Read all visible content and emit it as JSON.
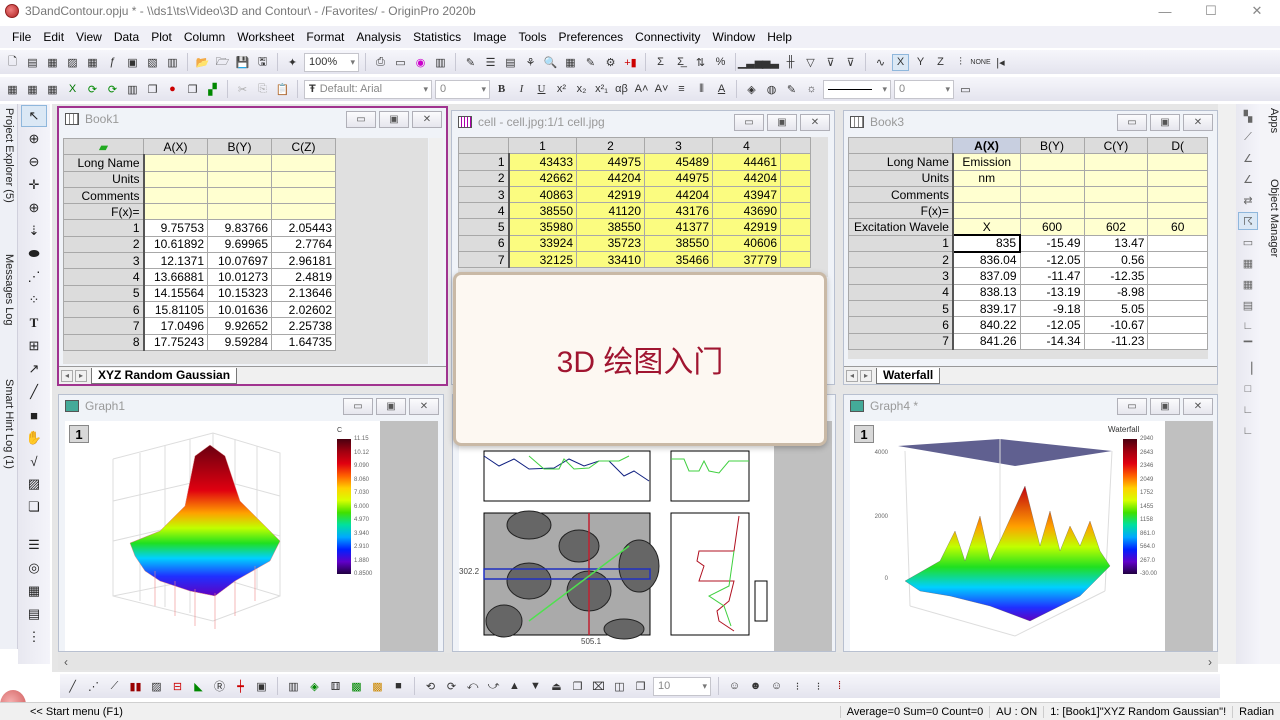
{
  "window": {
    "title": "3DandContour.opju * - \\\\ds1\\ts\\Video\\3D and Contour\\ - /Favorites/ - OriginPro 2020b",
    "controls": [
      "—",
      "☐",
      "✕"
    ]
  },
  "menu": [
    "File",
    "Edit",
    "View",
    "Data",
    "Plot",
    "Column",
    "Worksheet",
    "Format",
    "Analysis",
    "Statistics",
    "Image",
    "Tools",
    "Preferences",
    "Connectivity",
    "Window",
    "Help"
  ],
  "toolbar": {
    "zoom_value": "100%",
    "font_value": "Default: Arial",
    "font_size": "0",
    "line_width": "0",
    "bottom_size": "10"
  },
  "left_tabs": [
    "Project Explorer (5)",
    "Messages Log",
    "Smart Hint Log (1)"
  ],
  "right_tabs": [
    "Apps",
    "Object Manager"
  ],
  "book1": {
    "title": "Book1",
    "columns": [
      "A(X)",
      "B(Y)",
      "C(Z)"
    ],
    "meta_rows": [
      "Long Name",
      "Units",
      "Comments",
      "F(x)="
    ],
    "rows": [
      [
        "1",
        "9.75753",
        "9.83766",
        "2.05443"
      ],
      [
        "2",
        "10.61892",
        "9.69965",
        "2.7764"
      ],
      [
        "3",
        "12.1371",
        "10.07697",
        "2.96181"
      ],
      [
        "4",
        "13.66881",
        "10.01273",
        "2.4819"
      ],
      [
        "5",
        "14.15564",
        "10.15323",
        "2.13646"
      ],
      [
        "6",
        "15.81105",
        "10.01636",
        "2.02602"
      ],
      [
        "7",
        "17.0496",
        "9.92652",
        "2.25738"
      ],
      [
        "8",
        "17.75243",
        "9.59284",
        "1.64735"
      ]
    ],
    "sheet_tab": "XYZ Random Gaussian"
  },
  "cell": {
    "title": "cell - cell.jpg:1/1 cell.jpg",
    "columns": [
      "1",
      "2",
      "3",
      "4"
    ],
    "rows": [
      [
        "1",
        "43433",
        "44975",
        "45489",
        "44461"
      ],
      [
        "2",
        "42662",
        "44204",
        "44975",
        "44204"
      ],
      [
        "3",
        "40863",
        "42919",
        "44204",
        "43947"
      ],
      [
        "4",
        "38550",
        "41120",
        "43176",
        "43690"
      ],
      [
        "5",
        "35980",
        "38550",
        "41377",
        "42919"
      ],
      [
        "6",
        "33924",
        "35723",
        "38550",
        "40606"
      ],
      [
        "7",
        "32125",
        "33410",
        "35466",
        "37779"
      ]
    ]
  },
  "book3": {
    "title": "Book3",
    "columns": [
      "A(X)",
      "B(Y)",
      "C(Y)",
      "D("
    ],
    "meta": [
      [
        "Long Name",
        "Emission",
        "",
        ""
      ],
      [
        "Units",
        "nm",
        "",
        ""
      ],
      [
        "Comments",
        "",
        "",
        ""
      ],
      [
        "F(x)=",
        "",
        "",
        ""
      ],
      [
        "Excitation Wavele",
        "X",
        "600",
        "602"
      ]
    ],
    "rows": [
      [
        "1",
        "835",
        "-15.49",
        "13.47"
      ],
      [
        "2",
        "836.04",
        "-12.05",
        "0.56"
      ],
      [
        "3",
        "837.09",
        "-11.47",
        "-12.35"
      ],
      [
        "4",
        "838.13",
        "-13.19",
        "-8.98"
      ],
      [
        "5",
        "839.17",
        "-9.18",
        "5.05"
      ],
      [
        "6",
        "840.22",
        "-12.05",
        "-10.67"
      ],
      [
        "7",
        "841.26",
        "-14.34",
        "-11.23"
      ]
    ],
    "sheet_tab": "Waterfall",
    "partial_col": "60"
  },
  "graph1": {
    "title": "Graph1",
    "layer": "1",
    "colorbar_title": "C",
    "colorbar_ticks": [
      "11.15",
      "10.12",
      "9.090",
      "8.060",
      "7.030",
      "6.000",
      "4.970",
      "3.940",
      "2.910",
      "1.880",
      "0.8500"
    ]
  },
  "graph4": {
    "title": "Graph4 *",
    "layer": "1",
    "colorbar_title": "Waterfall",
    "colorbar_ticks": [
      "2940",
      "2643",
      "2346",
      "2049",
      "1752",
      "1455",
      "1158",
      "861.0",
      "564.0",
      "267.0",
      "-30.00"
    ],
    "z_ticks": [
      "4000",
      "2000",
      "0"
    ]
  },
  "cell_graph": {
    "crosshair_y": "302.2",
    "crosshair_x": "505.1"
  },
  "popup": {
    "text": "3D 绘图入门"
  },
  "status": {
    "start": "<< Start menu (F1)",
    "stats": "Average=0 Sum=0 Count=0",
    "au": "AU : ON",
    "active": "1: [Book1]\"XYZ Random Gaussian\"!",
    "angle": "Radian"
  }
}
